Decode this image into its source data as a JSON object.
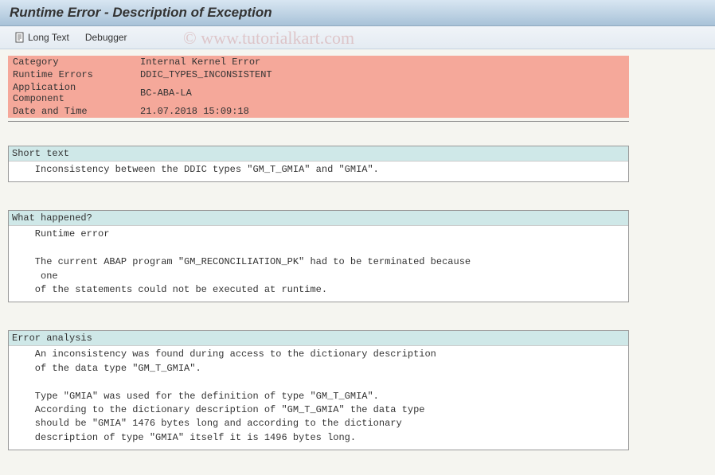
{
  "title": "Runtime Error - Description of Exception",
  "toolbar": {
    "long_text_label": "Long Text",
    "debugger_label": "Debugger"
  },
  "info": {
    "category_label": "Category",
    "category_value": "Internal Kernel Error",
    "runtime_errors_label": "Runtime Errors",
    "runtime_errors_value": "DDIC_TYPES_INCONSISTENT",
    "app_component_label": "Application Component",
    "app_component_value": "BC-ABA-LA",
    "datetime_label": "Date and Time",
    "datetime_value": "21.07.2018 15:09:18"
  },
  "sections": {
    "short_text": {
      "header": "Short text",
      "body": "    Inconsistency between the DDIC types \"GM_T_GMIA\" and \"GMIA\"."
    },
    "what_happened": {
      "header": "What happened?",
      "body": "    Runtime error\n\n    The current ABAP program \"GM_RECONCILIATION_PK\" had to be terminated because\n     one\n    of the statements could not be executed at runtime."
    },
    "error_analysis": {
      "header": "Error analysis",
      "body": "    An inconsistency was found during access to the dictionary description\n    of the data type \"GM_T_GMIA\".\n\n    Type \"GMIA\" was used for the definition of type \"GM_T_GMIA\".\n    According to the dictionary description of \"GM_T_GMIA\" the data type\n    should be \"GMIA\" 1476 bytes long and according to the dictionary\n    description of type \"GMIA\" itself it is 1496 bytes long."
    }
  },
  "watermark": "©  www.tutorialkart.com"
}
